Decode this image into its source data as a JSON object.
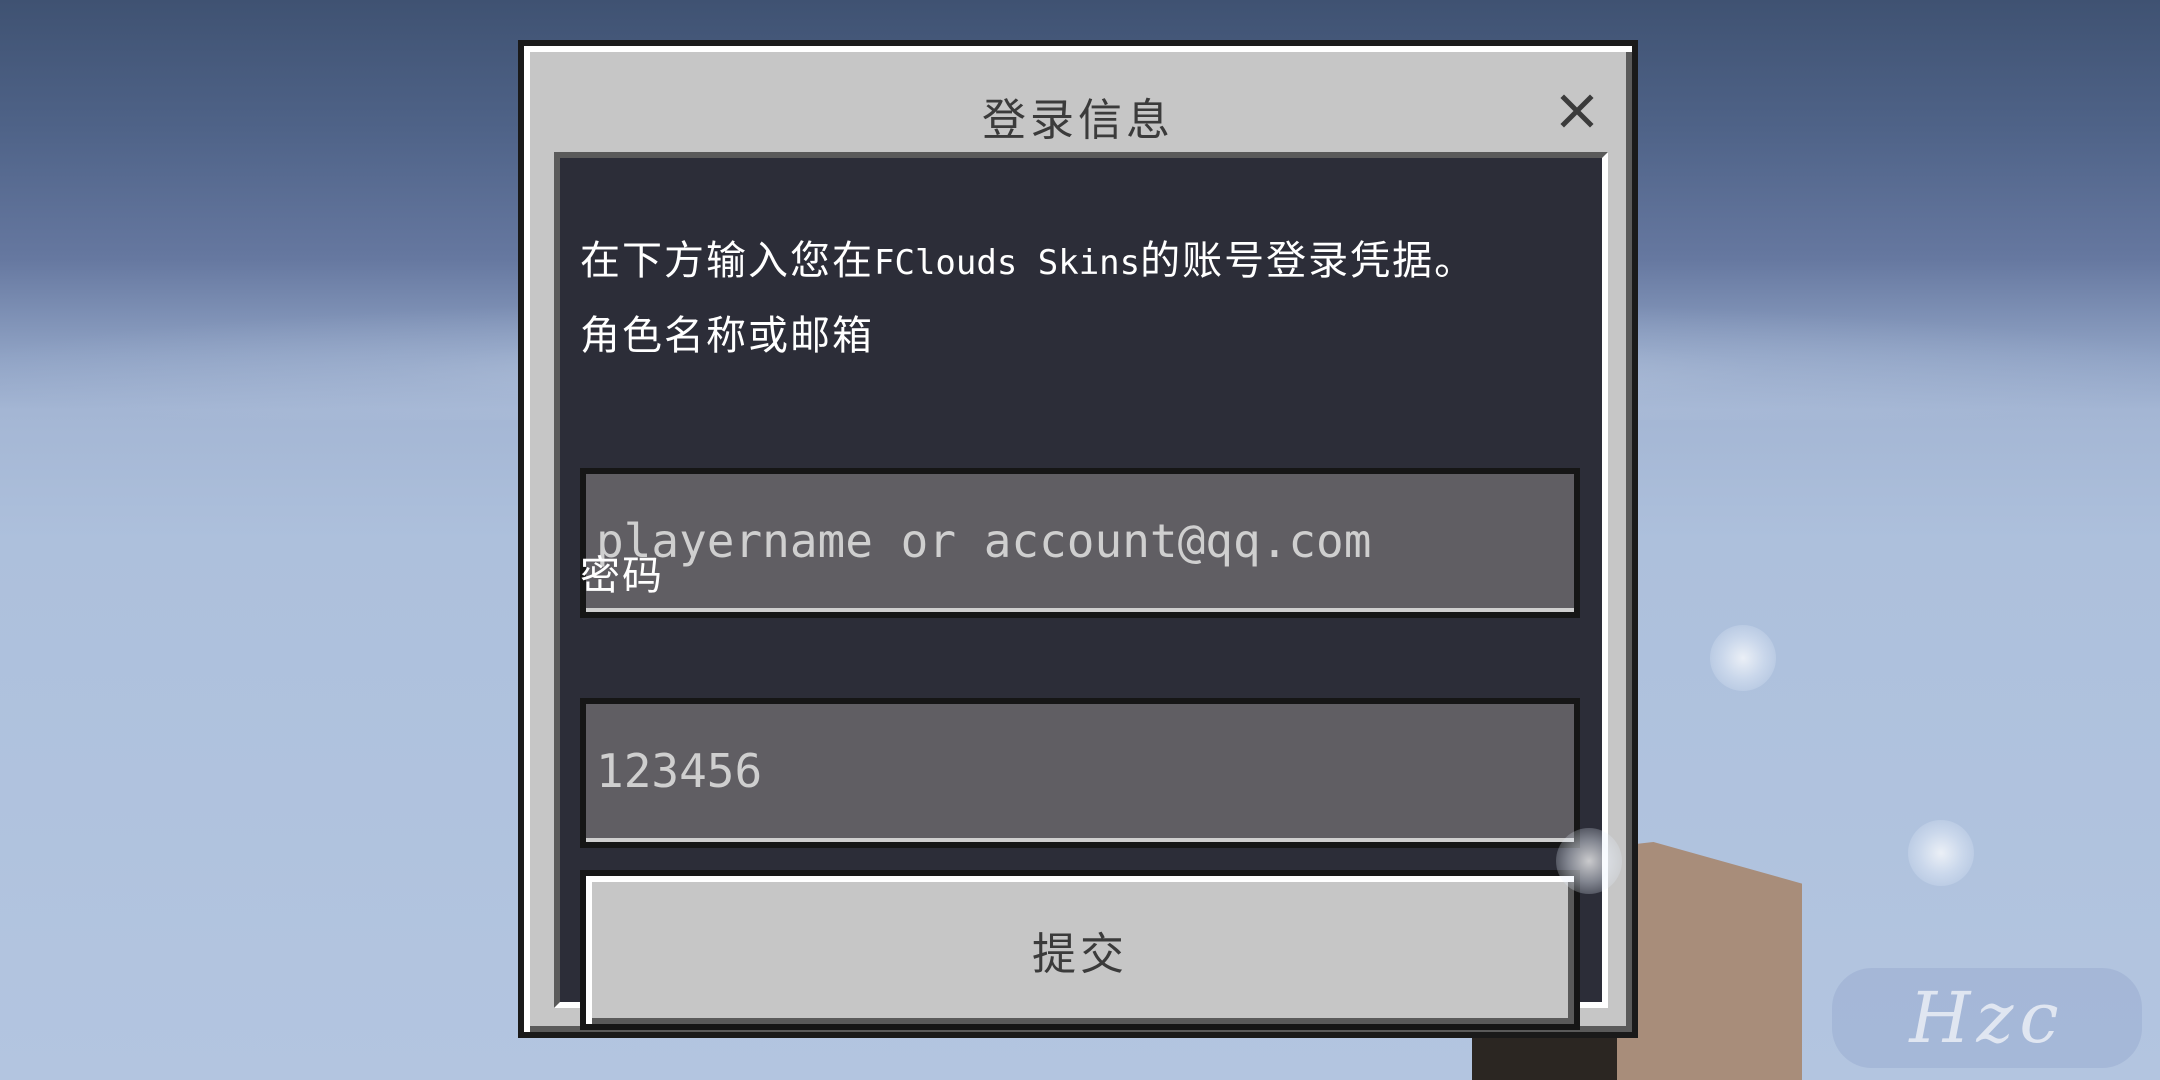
{
  "dialog": {
    "title": "登录信息",
    "close_icon": "close-icon",
    "description_prefix": "在下方输入您在",
    "description_brand": "FClouds Skins",
    "description_suffix": "的账号登录凭据。",
    "username_label": "角色名称或邮箱",
    "username_value": "playername or account@qq.com",
    "password_label": "密码",
    "password_value": "123456",
    "submit_label": "提交"
  },
  "watermark": {
    "text": "Hzc"
  },
  "colors": {
    "dialog_bg": "#c6c6c6",
    "panel_bg": "#2c2d38",
    "field_bg": "#605e63",
    "sky_top": "#3f5272",
    "sky_bottom": "#b3c5e0"
  }
}
